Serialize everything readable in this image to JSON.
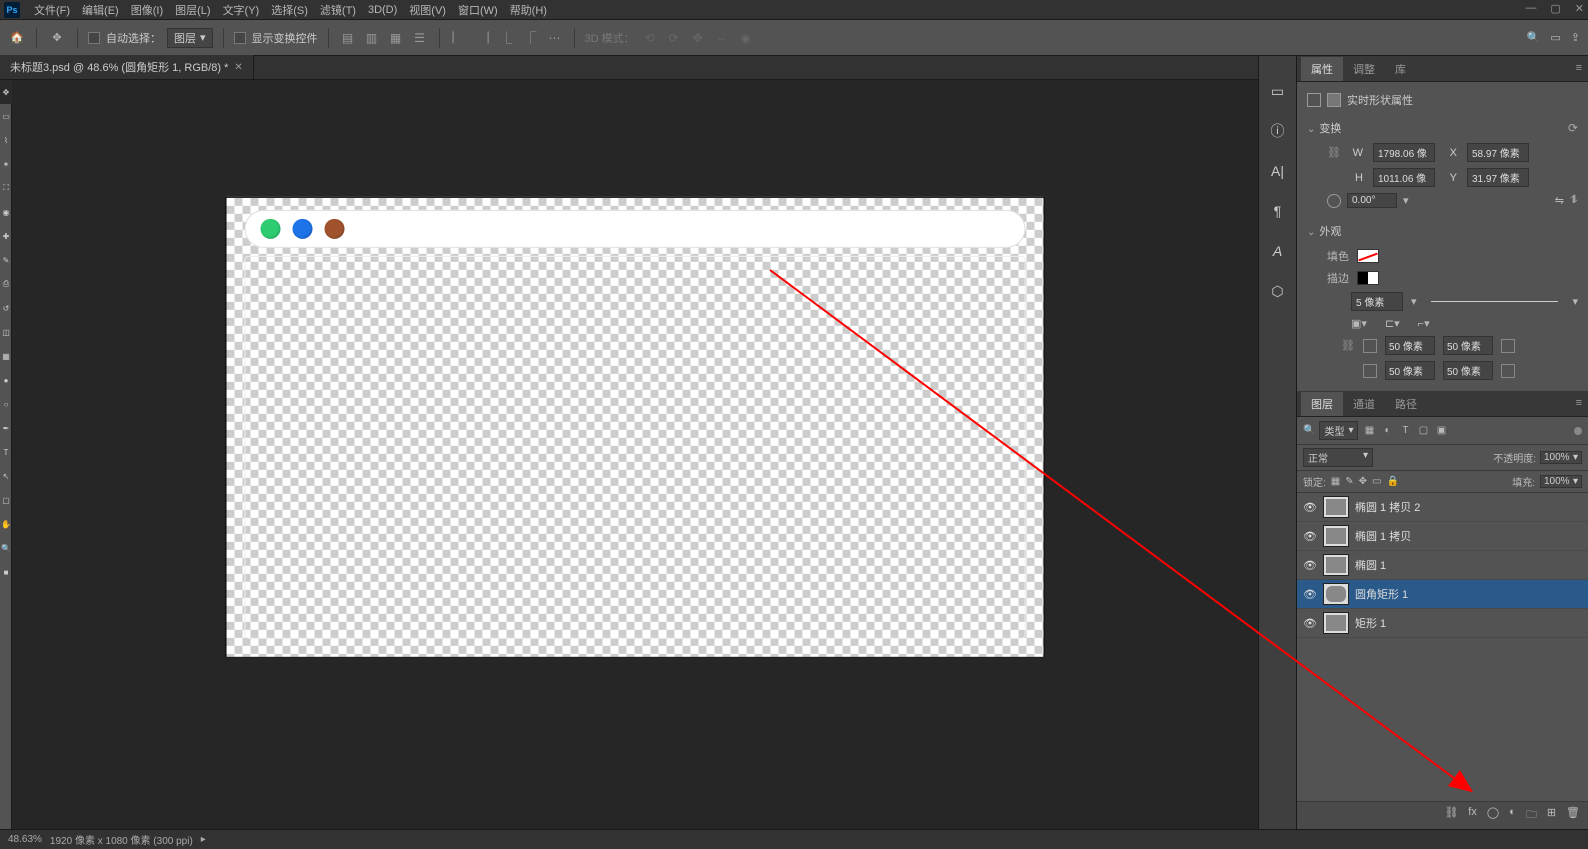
{
  "menu": [
    "文件(F)",
    "编辑(E)",
    "图像(I)",
    "图层(L)",
    "文字(Y)",
    "选择(S)",
    "滤镜(T)",
    "3D(D)",
    "视图(V)",
    "窗口(W)",
    "帮助(H)"
  ],
  "opt": {
    "auto_select": "自动选择：",
    "layer_kind": "图层",
    "show_transform": "显示变换控件",
    "mode_3d": "3D 模式："
  },
  "doc_tab": "未标题3.psd @ 48.6% (圆角矩形 1, RGB/8) *",
  "props": {
    "tabs": [
      "属性",
      "调整",
      "库"
    ],
    "header": "实时形状属性",
    "transform": "变换",
    "W": "W",
    "w_val": "1798.06 像",
    "X": "X",
    "x_val": "58.97 像素",
    "H": "H",
    "h_val": "1011.06 像",
    "Y": "Y",
    "y_val": "31.97 像素",
    "angle": "0.00°",
    "appearance": "外观",
    "fill": "填色",
    "stroke": "描边",
    "stroke_val": "5 像素",
    "corners": [
      "50 像素",
      "50 像素",
      "50 像素",
      "50 像素"
    ]
  },
  "layers": {
    "tabs": [
      "图层",
      "通道",
      "路径"
    ],
    "kind": "类型",
    "blend": "正常",
    "opacity_label": "不透明度:",
    "opacity": "100%",
    "lock_label": "锁定:",
    "fill_label": "填充:",
    "fill": "100%",
    "items": [
      "椭圆 1 拷贝 2",
      "椭圆 1 拷贝",
      "椭圆 1",
      "圆角矩形 1",
      "矩形 1"
    ]
  },
  "status": {
    "zoom": "48.63%",
    "dims": "1920 像素 x 1080 像素 (300 ppi)"
  }
}
